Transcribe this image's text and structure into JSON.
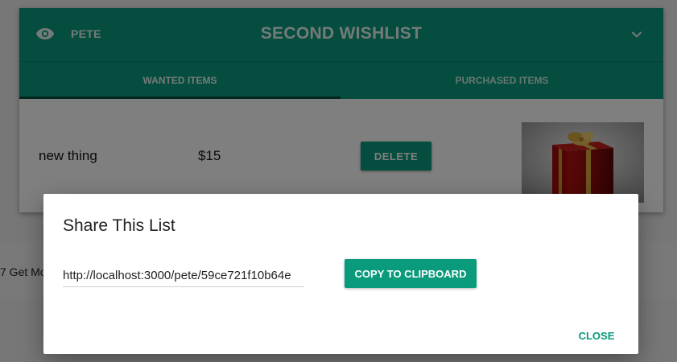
{
  "background": {
    "snippet_text": "7 Get Mo"
  },
  "wishlist": {
    "owner": "PETE",
    "title": "SECOND WISHLIST",
    "tabs": [
      {
        "label": "WANTED ITEMS",
        "active": true
      },
      {
        "label": "PURCHASED ITEMS",
        "active": false
      }
    ],
    "items": [
      {
        "name": "new thing",
        "price": "$15",
        "delete_label": "DELETE",
        "image": "gift-box"
      }
    ]
  },
  "dialog": {
    "title": "Share This List",
    "share_url": "http://localhost:3000/pete/59ce721f10b64e",
    "copy_label": "COPY TO CLIPBOARD",
    "close_label": "CLOSE"
  },
  "colors": {
    "accent": "#0a9a7c",
    "dark_accent": "#054a3b"
  },
  "icons": {
    "visibility": "eye-icon",
    "expand": "chevron-down-icon"
  }
}
